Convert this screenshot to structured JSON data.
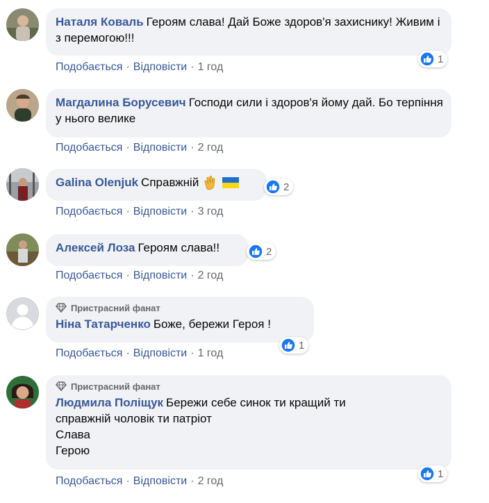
{
  "comments": [
    {
      "author": "Наталя Коваль",
      "text": "Героям слава! Дай Боже здоров'я захиснику! Живим і з перемогою!!!",
      "reaction_count": "1",
      "like": "Подобається",
      "reply": "Відповісти",
      "time": "1 год",
      "badge": ""
    },
    {
      "author": "Магдалина Борусевич",
      "text": "Господи сили і здоров'я йому дай. Бо терпіння у нього велике",
      "reaction_count": "",
      "like": "Подобається",
      "reply": "Відповісти",
      "time": "2 год",
      "badge": ""
    },
    {
      "author": "Galina Olenjuk",
      "text": "Справжній",
      "reaction_count": "2",
      "like": "Подобається",
      "reply": "Відповісти",
      "time": "3 год",
      "badge": ""
    },
    {
      "author": "Алексей Лоза",
      "text": "Героям слава!!",
      "reaction_count": "2",
      "like": "Подобається",
      "reply": "Відповісти",
      "time": "2 год",
      "badge": ""
    },
    {
      "author": "Ніна Татарченко",
      "text": "Боже, бережи Героя !",
      "reaction_count": "1",
      "like": "Подобається",
      "reply": "Відповісти",
      "time": "1 год",
      "badge": "Пристрасний фанат"
    },
    {
      "author": "Людмила Поліщук",
      "text": "Бережи себе синок ти кращий ти справжній чоловік ти патріот",
      "text2": "Слава",
      "text3": "Герою",
      "reaction_count": "1",
      "like": "Подобається",
      "reply": "Відповісти",
      "time": "2 год",
      "badge": "Пристрасний фанат"
    }
  ],
  "colors": {
    "bubble": "#f0f2f5",
    "author": "#385898",
    "like_blue": "#1877f2",
    "meta": "#65676b"
  },
  "icons": [
    "like-icon",
    "clap-emoji-icon",
    "ukraine-flag-icon",
    "diamond-badge-icon",
    "avatar"
  ]
}
